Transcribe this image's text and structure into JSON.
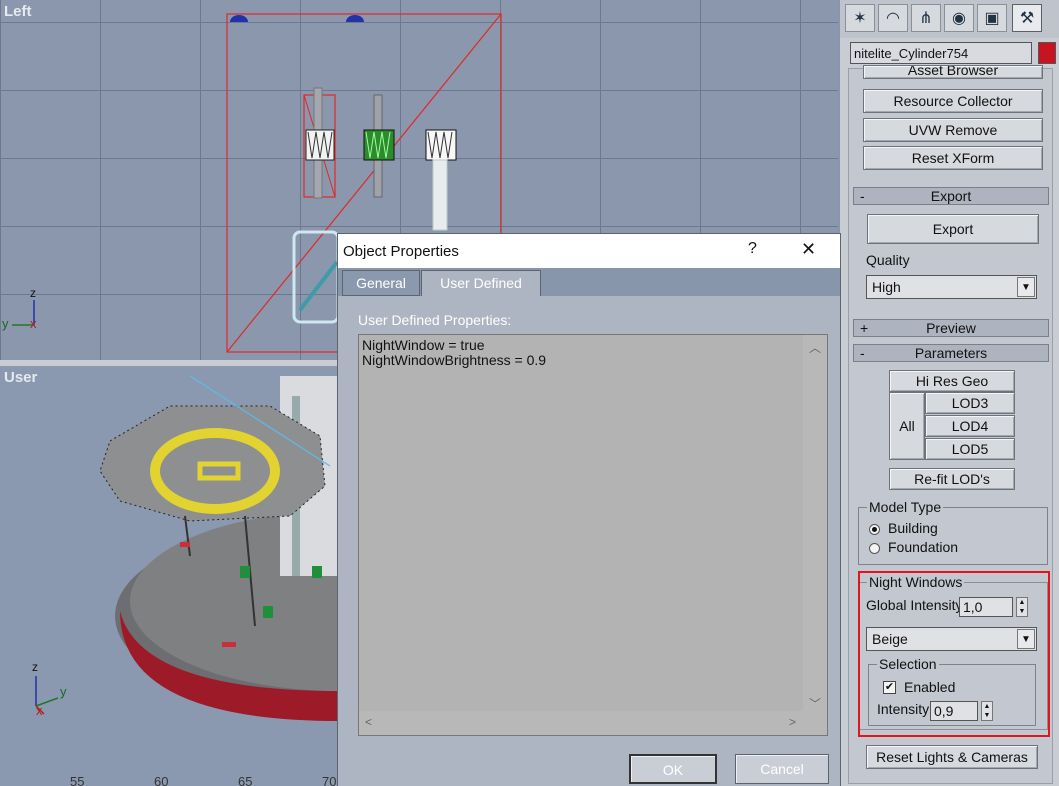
{
  "viewports": {
    "left_label": "Left",
    "user_label": "User",
    "ruler": [
      "55",
      "60",
      "65",
      "70"
    ],
    "axis_left": {
      "z": "z",
      "y": "y",
      "x": "x"
    },
    "axis_user": {
      "z": "z",
      "y": "y",
      "x": "x"
    }
  },
  "command_panel": {
    "tabs": [
      "create-icon",
      "modify-icon",
      "hierarchy-icon",
      "motion-icon",
      "display-icon",
      "utilities-icon"
    ],
    "object_name": "nitelite_Cylinder754",
    "object_color": "#c8141e",
    "buttons_top": [
      "Asset Browser",
      "Resource Collector",
      "UVW Remove",
      "Reset XForm"
    ],
    "export_rollout": {
      "sign": "-",
      "title": "Export",
      "button": "Export",
      "quality_label": "Quality",
      "quality_value": "High"
    },
    "preview_rollout": {
      "sign": "+",
      "title": "Preview"
    },
    "parameters_rollout": {
      "sign": "-",
      "title": "Parameters",
      "hi_res_geo": "Hi Res Geo",
      "all": "All",
      "lod3": "LOD3",
      "lod4": "LOD4",
      "lod5": "LOD5",
      "refit": "Re-fit LOD's",
      "model_type": {
        "title": "Model Type",
        "building": "Building",
        "foundation": "Foundation",
        "selected": "Building"
      },
      "night_windows": {
        "title": "Night Windows",
        "global_intensity_label": "Global Intensity",
        "global_intensity_value": "1,0",
        "color_value": "Beige",
        "selection": {
          "title": "Selection",
          "enabled_label": "Enabled",
          "enabled": true,
          "intensity_label": "Intensity",
          "intensity_value": "0,9"
        }
      },
      "reset_button": "Reset Lights & Cameras"
    }
  },
  "dialog": {
    "title": "Object Properties",
    "help": "?",
    "close": "✕",
    "tabs": [
      "General",
      "User Defined"
    ],
    "active_tab": "User Defined",
    "udp_label": "User Defined Properties:",
    "udp_text": "NightWindow = true\nNightWindowBrightness = 0.9",
    "ok": "OK",
    "cancel": "Cancel"
  }
}
